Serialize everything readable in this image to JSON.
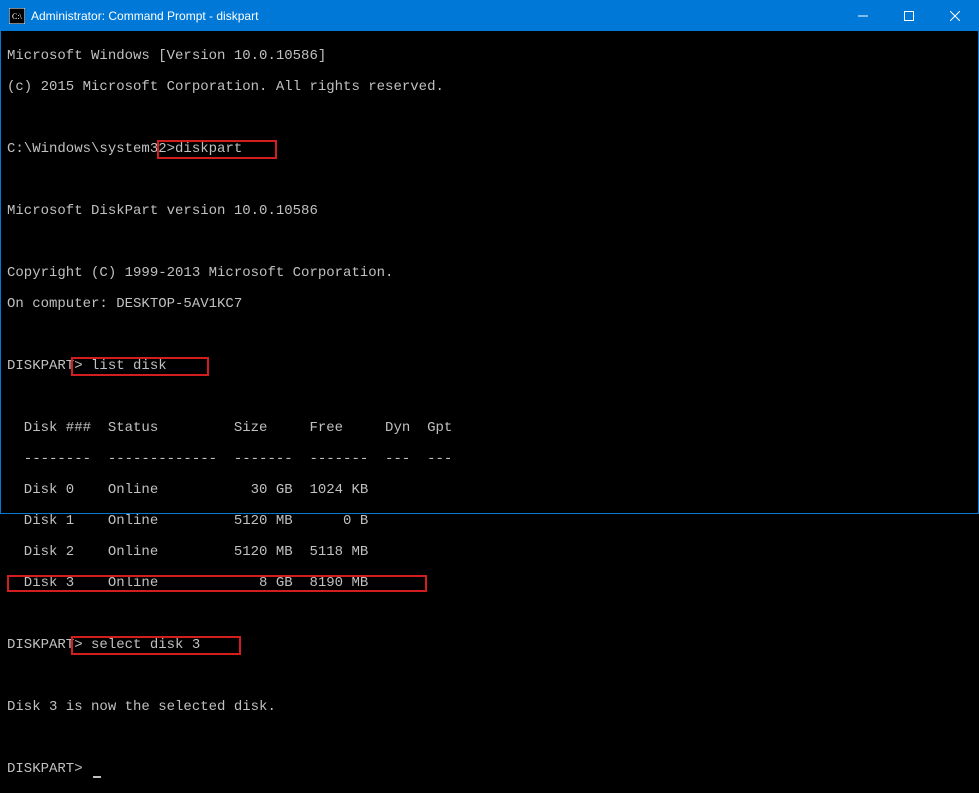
{
  "window": {
    "title": "Administrator: Command Prompt - diskpart"
  },
  "lines": {
    "l1": "Microsoft Windows [Version 10.0.10586]",
    "l2": "(c) 2015 Microsoft Corporation. All rights reserved.",
    "l3": "",
    "l4_prompt": "C:\\Windows\\system32>",
    "l4_cmd": "diskpart",
    "l5": "",
    "l6": "Microsoft DiskPart version 10.0.10586",
    "l7": "",
    "l8": "Copyright (C) 1999-2013 Microsoft Corporation.",
    "l9": "On computer: DESKTOP-5AV1KC7",
    "l10": "",
    "l11_prompt": "DISKPART> ",
    "l11_cmd": "list disk",
    "l12": "",
    "l13": "  Disk ###  Status         Size     Free     Dyn  Gpt",
    "l14": "  --------  -------------  -------  -------  ---  ---",
    "l15": "  Disk 0    Online           30 GB  1024 KB",
    "l16": "  Disk 1    Online         5120 MB      0 B",
    "l17": "  Disk 2    Online         5120 MB  5118 MB",
    "l18": "  Disk 3    Online            8 GB  8190 MB",
    "l19": "",
    "l20_prompt": "DISKPART> ",
    "l20_cmd": "select disk 3",
    "l21": "",
    "l22": "Disk 3 is now the selected disk.",
    "l23": "",
    "l24_prompt": "DISKPART> "
  },
  "disk_table": {
    "columns": [
      "Disk ###",
      "Status",
      "Size",
      "Free",
      "Dyn",
      "Gpt"
    ],
    "rows": [
      {
        "id": "Disk 0",
        "status": "Online",
        "size": "30 GB",
        "free": "1024 KB",
        "dyn": "",
        "gpt": ""
      },
      {
        "id": "Disk 1",
        "status": "Online",
        "size": "5120 MB",
        "free": "0 B",
        "dyn": "",
        "gpt": ""
      },
      {
        "id": "Disk 2",
        "status": "Online",
        "size": "5120 MB",
        "free": "5118 MB",
        "dyn": "",
        "gpt": ""
      },
      {
        "id": "Disk 3",
        "status": "Online",
        "size": "8 GB",
        "free": "8190 MB",
        "dyn": "",
        "gpt": ""
      }
    ]
  }
}
